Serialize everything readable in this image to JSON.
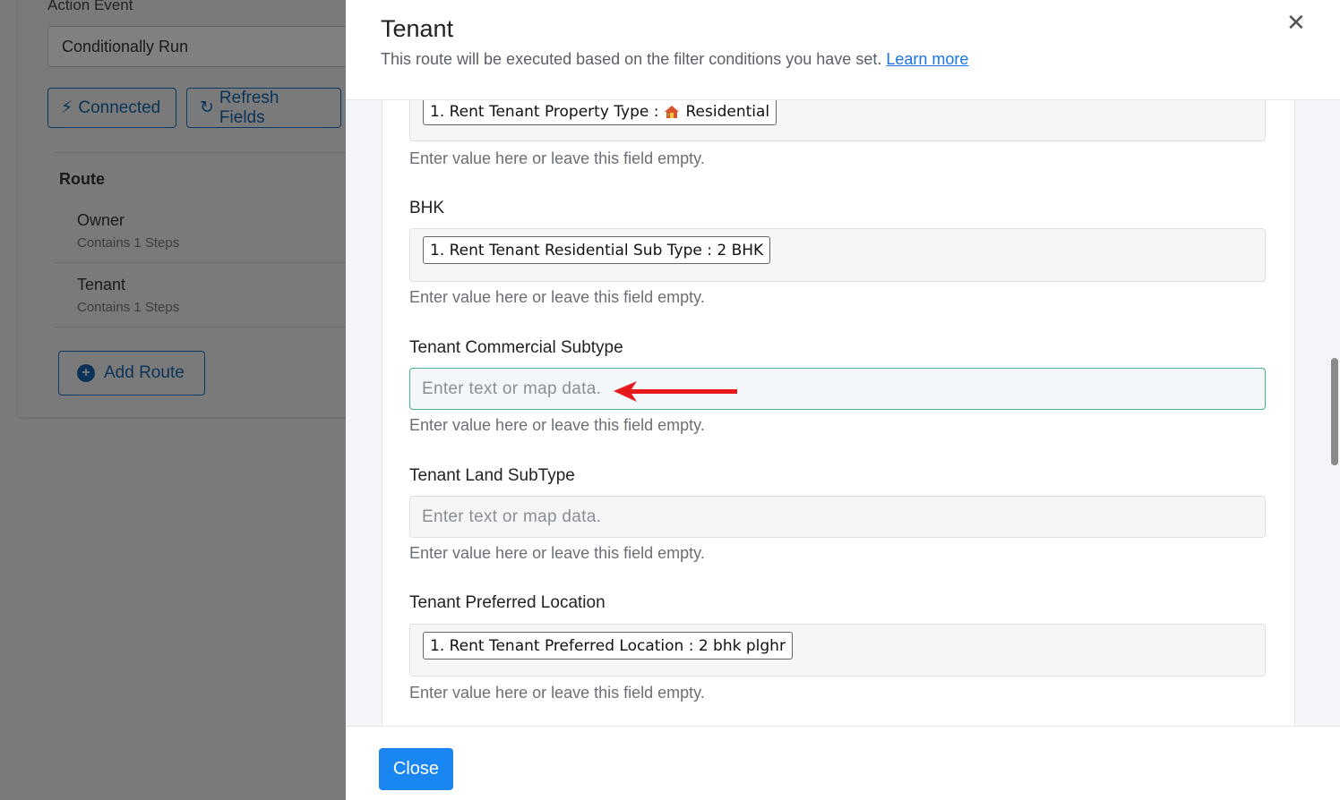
{
  "background": {
    "action_event_label": "Action Event",
    "action_event_value": "Conditionally Run",
    "connected_button": "Connected",
    "refresh_button": "Refresh Fields",
    "route_title": "Route",
    "routes": [
      {
        "name": "Owner",
        "steps": "Contains 1 Steps"
      },
      {
        "name": "Tenant",
        "steps": "Contains 1 Steps"
      }
    ],
    "add_route_button": "Add Route"
  },
  "modal": {
    "title": "Tenant",
    "subtitle": "This route will be executed based on the filter conditions you have set.",
    "learn_more": "Learn more",
    "close_icon": "close-icon",
    "close_button": "Close"
  },
  "fields": [
    {
      "label": "",
      "chip": "1. Rent Tenant Property Type : ",
      "chip_suffix": "Residential",
      "chip_icon": "house-icon",
      "help": "Enter value here or leave this field empty."
    },
    {
      "label": "BHK",
      "chip": "1. Rent Tenant Residential Sub Type : 2 BHK",
      "help": "Enter value here or leave this field empty."
    },
    {
      "label": "Tenant Commercial Subtype",
      "placeholder": "Enter text or map data.",
      "help": "Enter value here or leave this field empty."
    },
    {
      "label": "Tenant Land SubType",
      "placeholder": "Enter text or map data.",
      "help": "Enter value here or leave this field empty."
    },
    {
      "label": "Tenant Preferred Location",
      "chip": "1. Rent Tenant Preferred Location : 2 bhk plghr",
      "help": "Enter value here or leave this field empty."
    }
  ],
  "colors": {
    "accent": "#1a86f2",
    "focus_border": "#48b38a",
    "arrow": "#e5191b"
  }
}
